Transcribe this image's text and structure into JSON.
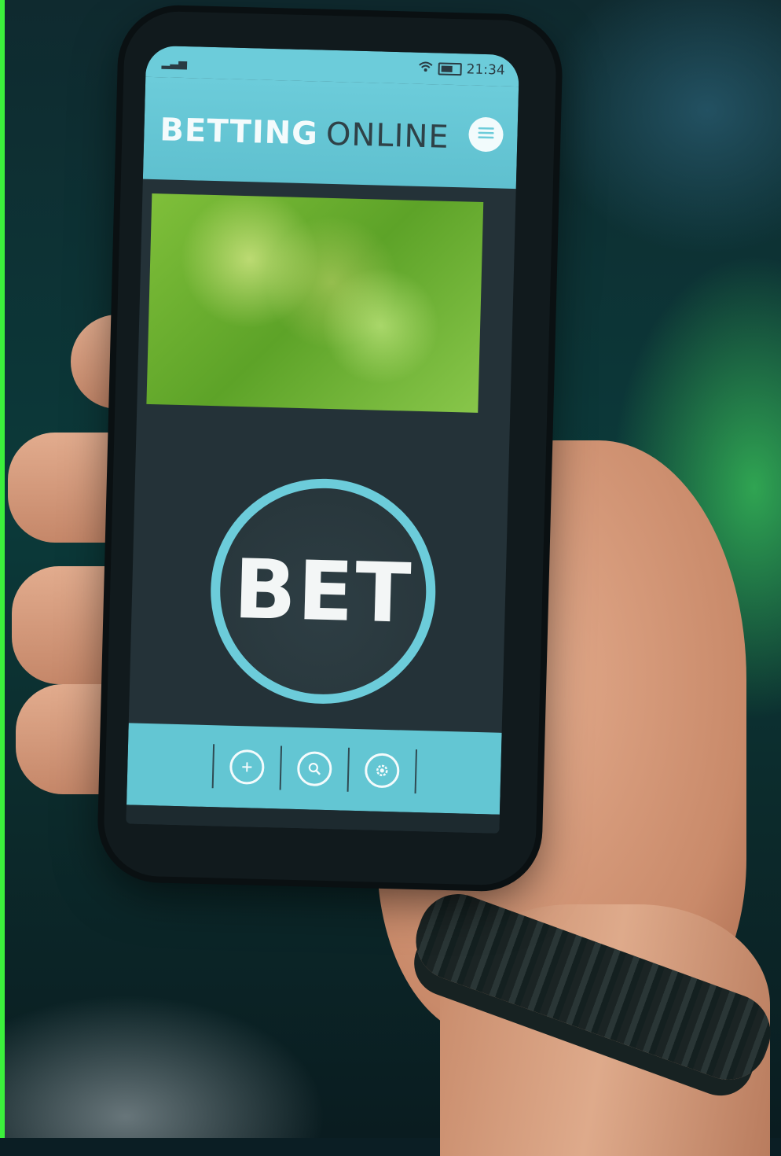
{
  "status_bar": {
    "time": "21:34"
  },
  "app_bar": {
    "title_bold": "BETTING",
    "title_light": "ONLINE",
    "menu_icon": "hamburger-menu-icon"
  },
  "main": {
    "bet_button_label": "BET"
  },
  "bottom_nav": {
    "items": [
      {
        "icon": "plus-icon"
      },
      {
        "icon": "search-icon"
      },
      {
        "icon": "settings-gear-icon"
      }
    ]
  },
  "colors": {
    "accent": "#6cccda",
    "screen_bg": "#243238",
    "banner_green": "#5da328"
  }
}
